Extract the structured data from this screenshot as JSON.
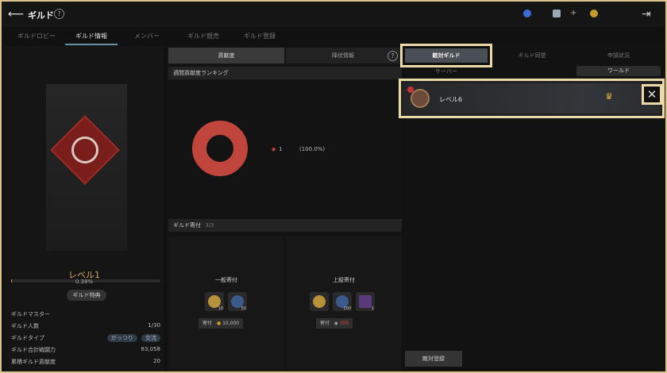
{
  "topbar": {
    "title": "ギルド",
    "help": "?"
  },
  "main_tabs": [
    "ギルドロビー",
    "ギルド情報",
    "メンバー",
    "ギルド競売",
    "ギルド登録"
  ],
  "left": {
    "level": "レベル1",
    "progress_pct": "0.38%",
    "progress_value": 0.0038,
    "perk_button": "ギルド特典",
    "stats": [
      {
        "label": "ギルドマスター",
        "value": ""
      },
      {
        "label": "ギルド人数",
        "value": "1/30"
      },
      {
        "label": "ギルドタイプ",
        "value": ""
      },
      {
        "label": "ギルド合計戦闘力",
        "value": "83,058"
      },
      {
        "label": "累積ギルド貢献度",
        "value": "20"
      }
    ],
    "guild_type_tags": [
      "がっつり",
      "交流"
    ]
  },
  "mid": {
    "tabs": [
      "貢献度",
      "降伏情報"
    ],
    "help": "?",
    "ranking_header": "週間貢献度ランキング",
    "legend_rank": "1",
    "legend_pct": "(100.0%)",
    "donation_header": "ギルド寄付",
    "donation_count": "3/3",
    "normal": {
      "label": "一般寄付",
      "slots": [
        "10",
        "50"
      ],
      "button": "寄付",
      "cost": "10,000"
    },
    "premium": {
      "label": "上級寄付",
      "slots": [
        "",
        "200",
        "1"
      ],
      "button": "寄付",
      "cost": "300"
    }
  },
  "right": {
    "tabs": [
      "敵対ギルド",
      "ギルド同盟",
      "申請状況"
    ],
    "filters": {
      "server": "サーバー",
      "world": "ワールド"
    },
    "guild_name": "レベル6",
    "register_button": "敵対登録"
  },
  "colors": {
    "accent": "#ecd9a8",
    "donut": "#c0453c",
    "gold": "#cfa85a"
  }
}
